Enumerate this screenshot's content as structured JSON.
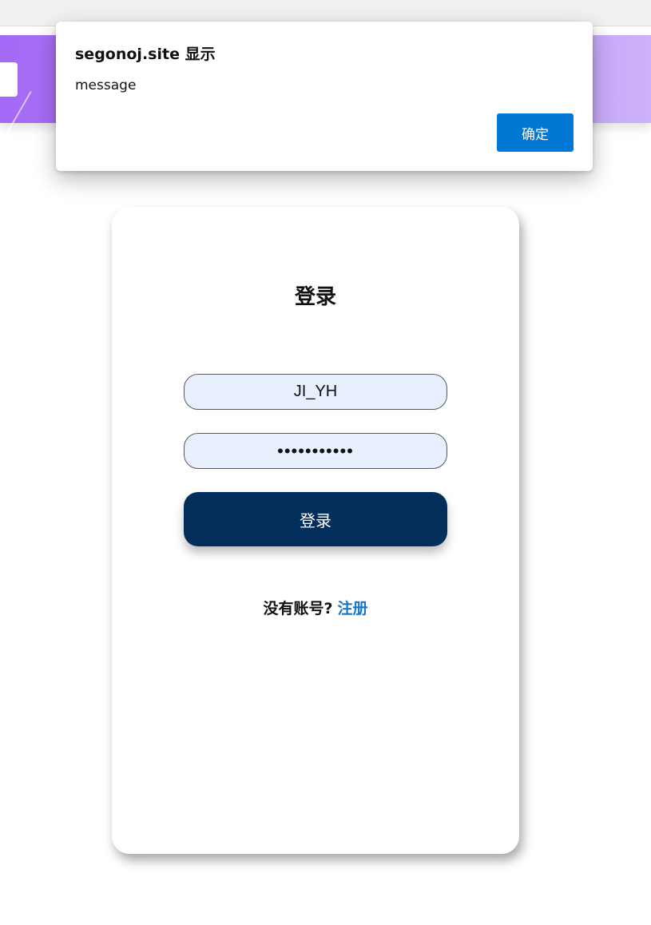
{
  "dialog": {
    "title": "segonoj.site 显示",
    "message": "message",
    "ok_label": "确定"
  },
  "login": {
    "title": "登录",
    "username_value": "JI_YH",
    "password_value": "•••••••••••",
    "submit_label": "登录",
    "no_account_text": "没有账号?",
    "register_label": "注册"
  },
  "colors": {
    "header_gradient_start": "#a469f5",
    "header_gradient_end": "#ccb1f9",
    "submit_button": "#032d5a",
    "register_link": "#1876c8",
    "dialog_button": "#0078d4"
  }
}
